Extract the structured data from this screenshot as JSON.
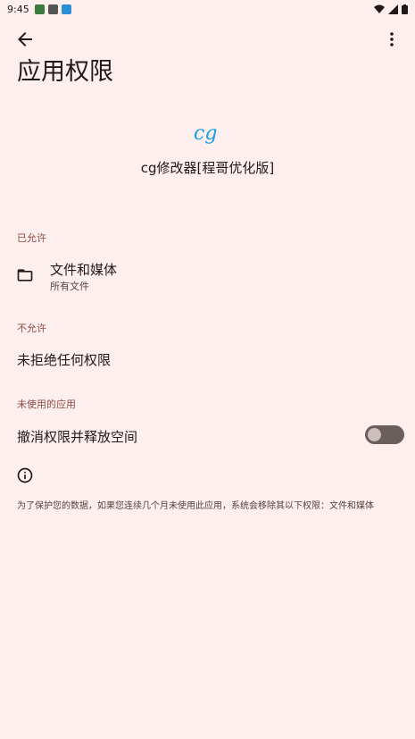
{
  "status_bar": {
    "time": "9:45",
    "icons": [
      "notification-icon",
      "android-icon",
      "app-notification-icon"
    ],
    "right_icons": [
      "wifi-icon",
      "signal-icon",
      "battery-icon"
    ]
  },
  "header": {
    "title": "应用权限",
    "back_icon": "arrow-back-icon",
    "more_icon": "more-vert-icon"
  },
  "app": {
    "logo_text": "cg",
    "name": "cg修改器[程哥优化版]",
    "logo_color": "#1aa0e0"
  },
  "sections": {
    "allowed": {
      "header": "已允许",
      "items": [
        {
          "icon": "folder-icon",
          "title": "文件和媒体",
          "subtitle": "所有文件"
        }
      ]
    },
    "denied": {
      "header": "不允许",
      "empty_text": "未拒绝任何权限"
    },
    "unused": {
      "header": "未使用的应用",
      "toggle_label": "撤消权限并释放空间",
      "toggle_on": false
    }
  },
  "info": {
    "icon": "info-icon",
    "text": "为了保护您的数据，如果您连续几个月未使用此应用，系统会移除其以下权限：文件和媒体"
  },
  "colors": {
    "background": "#fcefed",
    "accent": "#904a43",
    "text": "#201a19"
  }
}
